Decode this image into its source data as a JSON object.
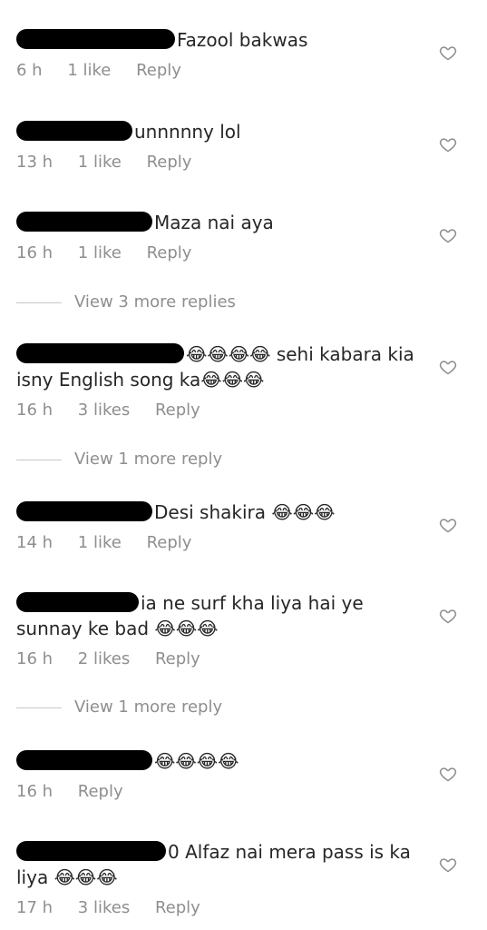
{
  "comments": [
    {
      "text": "Fazool bakwas",
      "time": "6 h",
      "likes": "1 like",
      "reply": "Reply",
      "redact_w": 175
    },
    {
      "text": "unnnnny lol",
      "time": "13 h",
      "likes": "1 like",
      "reply": "Reply",
      "redact_w": 128
    },
    {
      "text": "Maza nai aya",
      "time": "16 h",
      "likes": "1 like",
      "reply": "Reply",
      "redact_w": 150
    },
    {
      "text": "😂😂😂😂 sehi kabara kia isny English song ka😂😂😂",
      "time": "16 h",
      "likes": "3 likes",
      "reply": "Reply",
      "redact_w": 185
    },
    {
      "text": "Desi shakira 😂😂😂",
      "time": "14 h",
      "likes": "1 like",
      "reply": "Reply",
      "redact_w": 150
    },
    {
      "text": "ia ne surf kha liya hai ye sunnay ke bad 😂😂😂",
      "time": "16 h",
      "likes": "2 likes",
      "reply": "Reply",
      "redact_w": 135
    },
    {
      "text": "😂😂😂😂",
      "time": "16 h",
      "likes": "",
      "reply": "Reply",
      "redact_w": 150
    },
    {
      "text": "0 Alfaz nai mera pass is ka liya 😂😂😂",
      "time": "17 h",
      "likes": "3 likes",
      "reply": "Reply",
      "redact_w": 165
    }
  ],
  "view_more": [
    {
      "label": "View 3 more replies"
    },
    {
      "label": "View 1 more reply"
    },
    {
      "label": "View 1 more reply"
    }
  ],
  "colors": {
    "text": "#262626",
    "meta": "#8e8e8e",
    "redaction": "#000000"
  }
}
